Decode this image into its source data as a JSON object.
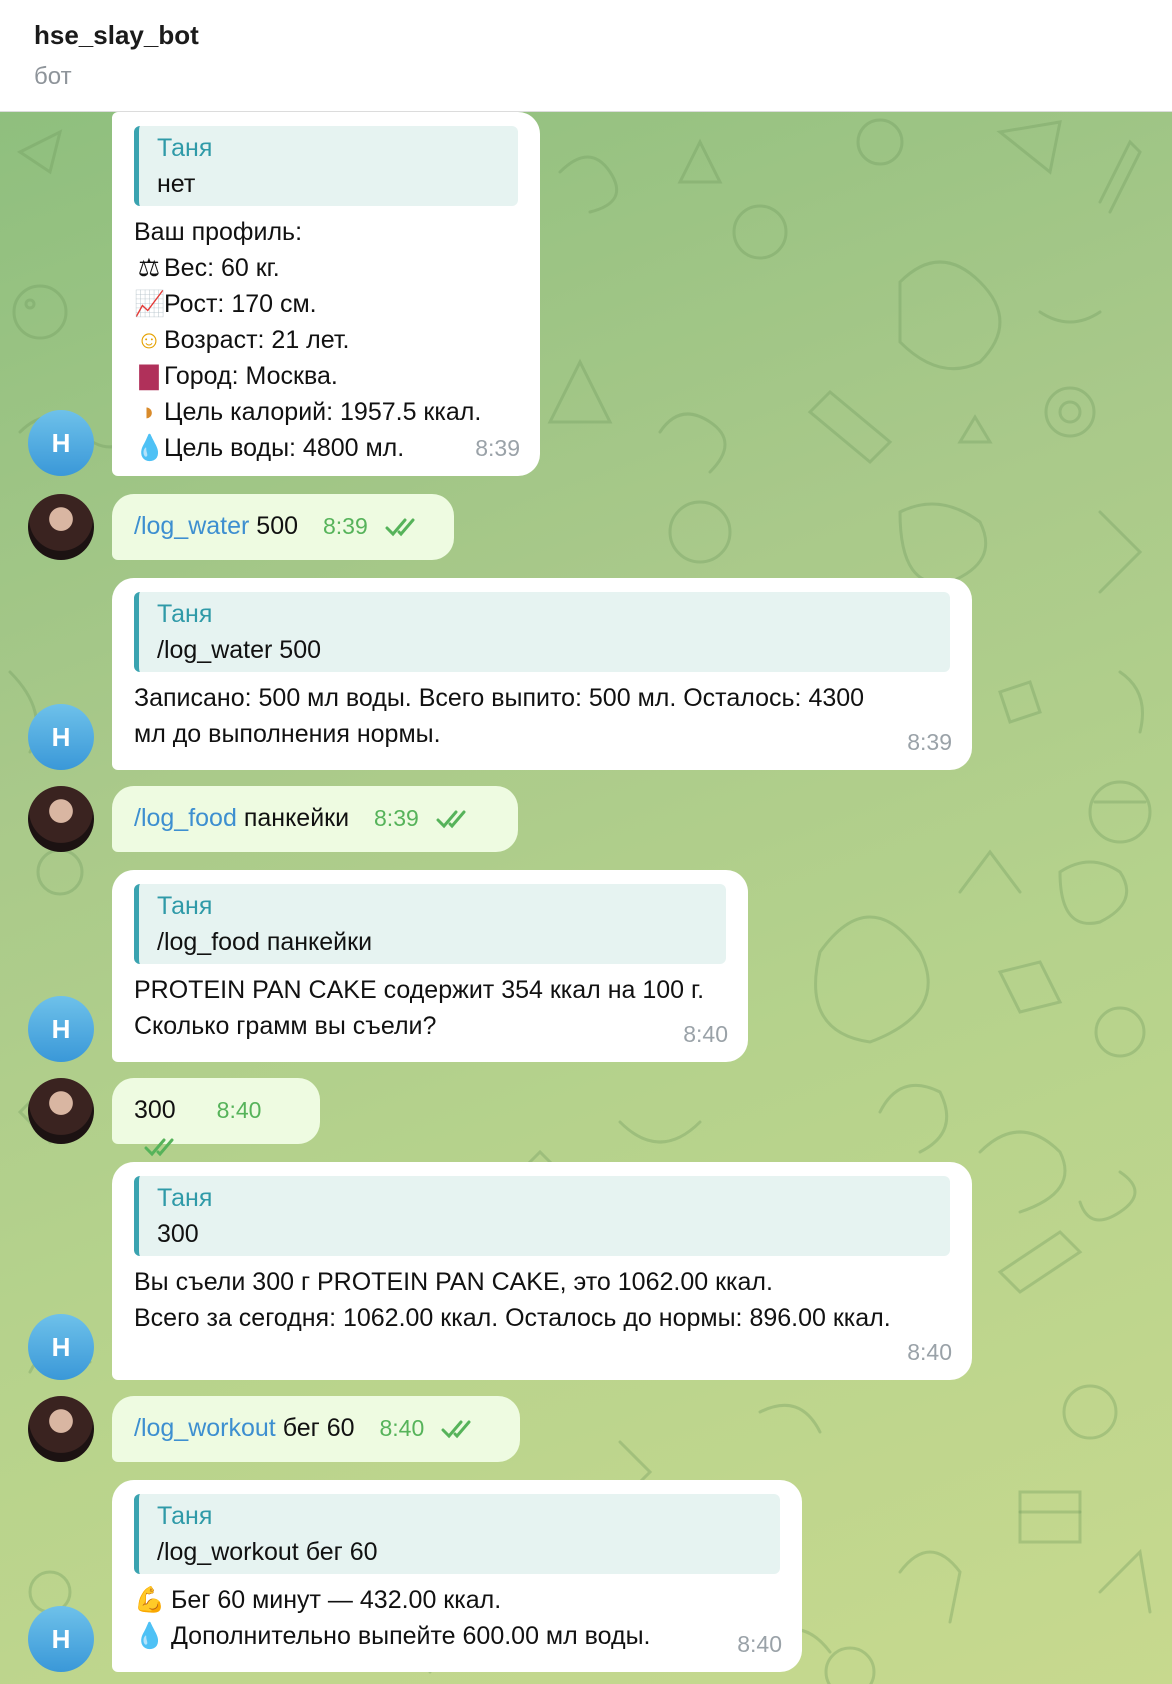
{
  "header": {
    "title": "hse_slay_bot",
    "subtitle": "бот"
  },
  "bot_avatar_letter": "Н",
  "messages": {
    "m1": {
      "quote_name": "Таня",
      "quote_text": "нет",
      "lines": [
        "Ваш профиль:",
        "Вес: 60 кг.",
        "Рост: 170 см.",
        "Возраст: 21 лет.",
        "Город: Москва.",
        "Цель калорий: 1957.5 ккал.",
        "Цель воды: 4800 мл."
      ],
      "icons": [
        "scales-icon",
        "chart-increasing-icon",
        "person-icon",
        "cityscape-icon",
        "croissant-icon",
        "droplet-icon"
      ],
      "time": "8:39"
    },
    "m2": {
      "cmd": "/log_water",
      "arg": " 500",
      "time": "8:39"
    },
    "m3": {
      "quote_name": "Таня",
      "quote_text": "/log_water 500",
      "lines": [
        "Записано: 500 мл воды. Всего выпито: 500 мл. Осталось: 4300",
        "мл до выполнения нормы."
      ],
      "time": "8:39"
    },
    "m4": {
      "cmd": "/log_food",
      "arg": " панкейки",
      "time": "8:39"
    },
    "m5": {
      "quote_name": "Таня",
      "quote_text": "/log_food панкейки",
      "lines": [
        "PROTEIN PAN CAKE содержит 354 ккал на 100 г.",
        "Сколько грамм вы съели?"
      ],
      "time": "8:40"
    },
    "m6": {
      "cmd": "",
      "arg": "300",
      "time": "8:40"
    },
    "m7": {
      "quote_name": "Таня",
      "quote_text": "300",
      "lines": [
        "Вы съели 300 г PROTEIN PAN CAKE, это 1062.00 ккал.",
        "Всего за сегодня: 1062.00 ккал. Осталось до нормы: 896.00 ккал."
      ],
      "time": "8:40"
    },
    "m8": {
      "cmd": "/log_workout",
      "arg": " бег 60",
      "time": "8:40"
    },
    "m9": {
      "quote_name": "Таня",
      "quote_text": "/log_workout бег 60",
      "lines": [
        "Бег 60 минут — 432.00 ккал.",
        "Дополнительно выпейте 600.00 мл воды."
      ],
      "icons": [
        "flexed-biceps-icon",
        "droplet-icon"
      ],
      "time": "8:40"
    }
  },
  "colors": {
    "outgoing_bubble": "#eefbe1",
    "incoming_bubble": "#ffffff",
    "quote_accent": "#3aa3b0",
    "command_link": "#3d8fd0",
    "read_ticks": "#56b35a"
  }
}
